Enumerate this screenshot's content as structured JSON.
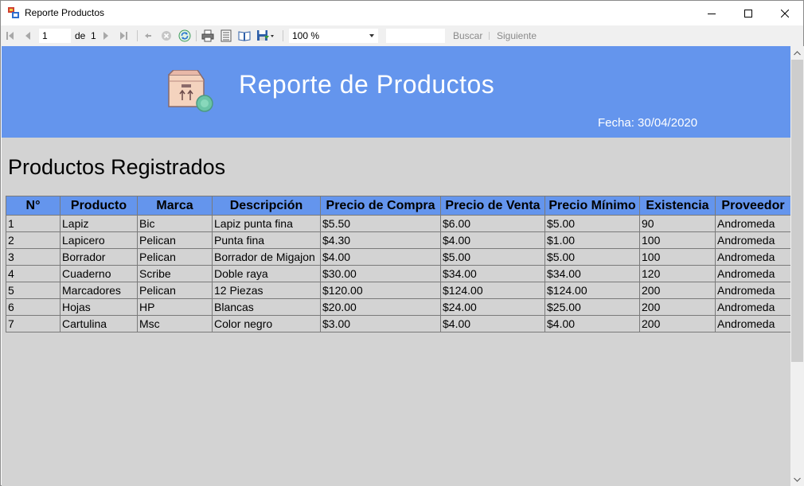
{
  "window": {
    "title": "Reporte Productos"
  },
  "toolbar": {
    "page_value": "1",
    "of_label": "de",
    "total_pages": "1",
    "zoom": "100 %",
    "search_value": "",
    "find_label": "Buscar",
    "next_label": "Siguiente"
  },
  "report": {
    "banner_title": "Reporte de Productos",
    "date_text": "Fecha: 30/04/2020",
    "section_title": "Productos Registrados",
    "banner_color": "#6495ed",
    "background_color": "#d3d3d3",
    "columns": [
      "N°",
      "Producto",
      "Marca",
      "Descripción",
      "Precio de Compra",
      "Precio de Venta",
      "Precio Mínimo",
      "Existencia",
      "Proveedor"
    ],
    "rows": [
      [
        "1",
        "Lapiz",
        "Bic",
        "Lapiz punta fina",
        "$5.50",
        "$6.00",
        "$5.00",
        "90",
        "Andromeda"
      ],
      [
        "2",
        "Lapicero",
        "Pelican",
        "Punta fina",
        "$4.30",
        "$4.00",
        "$1.00",
        "100",
        "Andromeda"
      ],
      [
        "3",
        "Borrador",
        "Pelican",
        "Borrador de Migajon",
        "$4.00",
        "$5.00",
        "$5.00",
        "100",
        "Andromeda"
      ],
      [
        "4",
        "Cuaderno",
        "Scribe",
        "Doble raya",
        "$30.00",
        "$34.00",
        "$34.00",
        "120",
        "Andromeda"
      ],
      [
        "5",
        "Marcadores",
        "Pelican",
        "12 Piezas",
        "$120.00",
        "$124.00",
        "$124.00",
        "200",
        "Andromeda"
      ],
      [
        "6",
        "Hojas",
        "HP",
        "Blancas",
        "$20.00",
        "$24.00",
        "$25.00",
        "200",
        "Andromeda"
      ],
      [
        "7",
        "Cartulina",
        "Msc",
        "Color negro",
        "$3.00",
        "$4.00",
        "$4.00",
        "200",
        "Andromeda"
      ]
    ]
  }
}
